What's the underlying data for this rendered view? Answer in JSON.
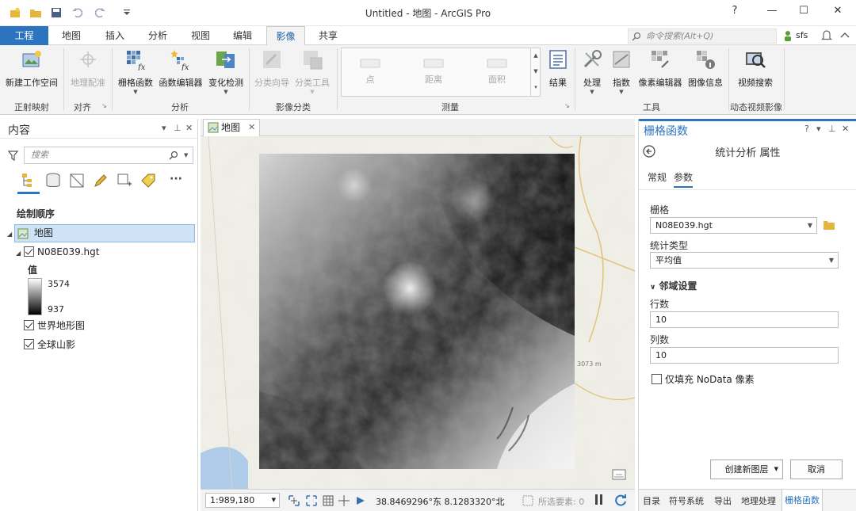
{
  "window": {
    "title": "Untitled - 地图 - ArcGIS Pro",
    "help": "?",
    "minimize": "—",
    "maximize": "☐",
    "close": "✕"
  },
  "ribbon_tabs": [
    "工程",
    "地图",
    "插入",
    "分析",
    "视图",
    "编辑",
    "影像",
    "共享"
  ],
  "active_tab": "影像",
  "command_search": {
    "placeholder": "命令搜索(Alt+Q)"
  },
  "user": {
    "name": "sfs"
  },
  "ribbon": {
    "groups": [
      {
        "label": "正射映射",
        "buttons": [
          {
            "label": "新建工作空间",
            "enabled": true,
            "icon": "workspace-icon"
          }
        ]
      },
      {
        "label": "对齐",
        "buttons": [
          {
            "label": "地理配准",
            "enabled": false,
            "icon": "georeference-icon"
          }
        ]
      },
      {
        "label": "分析",
        "buttons": [
          {
            "label": "栅格函数",
            "enabled": true,
            "icon": "raster-function-icon"
          },
          {
            "label": "函数编辑器",
            "enabled": true,
            "icon": "function-editor-icon"
          },
          {
            "label": "变化检测",
            "enabled": true,
            "icon": "change-detection-icon"
          }
        ]
      },
      {
        "label": "影像分类",
        "buttons": [
          {
            "label": "分类向导",
            "enabled": false,
            "icon": "classification-wizard-icon"
          },
          {
            "label": "分类工具",
            "enabled": false,
            "icon": "classification-tools-icon"
          }
        ]
      },
      {
        "label": "测量",
        "buttons": [
          {
            "label": "点",
            "enabled": false,
            "icon": "point-measure-icon"
          },
          {
            "label": "距离",
            "enabled": false,
            "icon": "distance-measure-icon"
          },
          {
            "label": "面积",
            "enabled": false,
            "icon": "area-measure-icon"
          },
          {
            "label": "结果",
            "enabled": true,
            "icon": "results-icon"
          }
        ]
      },
      {
        "label": "工具",
        "buttons": [
          {
            "label": "处理",
            "enabled": true,
            "icon": "processing-icon"
          },
          {
            "label": "指数",
            "enabled": true,
            "icon": "indices-icon"
          },
          {
            "label": "像素编辑器",
            "enabled": true,
            "icon": "pixel-editor-icon"
          },
          {
            "label": "图像信息",
            "enabled": true,
            "icon": "image-info-icon"
          }
        ]
      },
      {
        "label": "动态视频影像",
        "buttons": [
          {
            "label": "视频搜索",
            "enabled": true,
            "icon": "video-search-icon"
          }
        ]
      }
    ]
  },
  "contents": {
    "title": "内容",
    "search_placeholder": "搜索",
    "draw_order_label": "绘制顺序",
    "map_name": "地图",
    "layers": [
      {
        "name": "N08E039.hgt",
        "checked": true
      },
      {
        "name": "世界地形图",
        "checked": true
      },
      {
        "name": "全球山影",
        "checked": true
      }
    ],
    "legend": {
      "title": "值",
      "high": "3574",
      "low": "937"
    }
  },
  "map": {
    "tab_label": "地图",
    "scale": "1:989,180",
    "coordinates": "38.8469296°东 8.1283320°北",
    "selected_features": "所选要素: 0",
    "basemap_labels": [
      "3073 m"
    ]
  },
  "geoprocessing": {
    "panel_title": "栅格函数",
    "tool_title": "统计分析 属性",
    "tabs": [
      "常规",
      "参数"
    ],
    "active_tab": "参数",
    "raster_label": "栅格",
    "raster_value": "N08E039.hgt",
    "stat_type_label": "统计类型",
    "stat_type_value": "平均值",
    "neighborhood_label": "邻域设置",
    "rows_label": "行数",
    "rows_value": "10",
    "cols_label": "列数",
    "cols_value": "10",
    "nodata_label": "仅填充 NoData 像素",
    "nodata_checked": false,
    "create_button": "创建新图层",
    "cancel_button": "取消"
  },
  "bottom_tabs": [
    "目录",
    "符号系统",
    "导出",
    "地理处理",
    "栅格函数"
  ],
  "bottom_active": "栅格函数",
  "colors": {
    "accent": "#2c74c0",
    "ribbon_bg": "#f3f3f3"
  }
}
